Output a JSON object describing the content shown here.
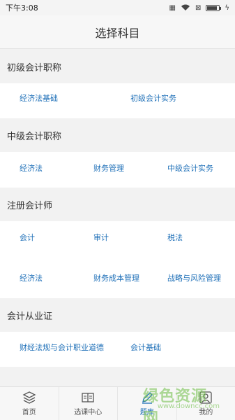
{
  "status": {
    "time": "下午3:08"
  },
  "title": "选择科目",
  "sections": [
    {
      "header": "初级会计职称",
      "subjects": [
        "经济法基础",
        "初级会计实务"
      ]
    },
    {
      "header": "中级会计职称",
      "subjects": [
        "经济法",
        "财务管理",
        "中级会计实务"
      ]
    },
    {
      "header": "注册会计师",
      "subjects": [
        "会计",
        "审计",
        "税法",
        "经济法",
        "财务成本管理",
        "战略与风险管理"
      ]
    },
    {
      "header": "会计从业证",
      "subjects": [
        "财经法规与会计职业道德",
        "会计基础"
      ]
    }
  ],
  "tabs": [
    {
      "label": "首页",
      "icon": "layers-icon"
    },
    {
      "label": "选课中心",
      "icon": "book-icon"
    },
    {
      "label": "题库",
      "icon": "pencil-icon"
    },
    {
      "label": "我的",
      "icon": "person-icon"
    }
  ],
  "watermark": {
    "main": "绿色资源网",
    "url": "www.downcc.com"
  },
  "colors": {
    "accent": "#1f70b8",
    "background": "#f2f2f2",
    "watermark": "#6ebe46"
  }
}
